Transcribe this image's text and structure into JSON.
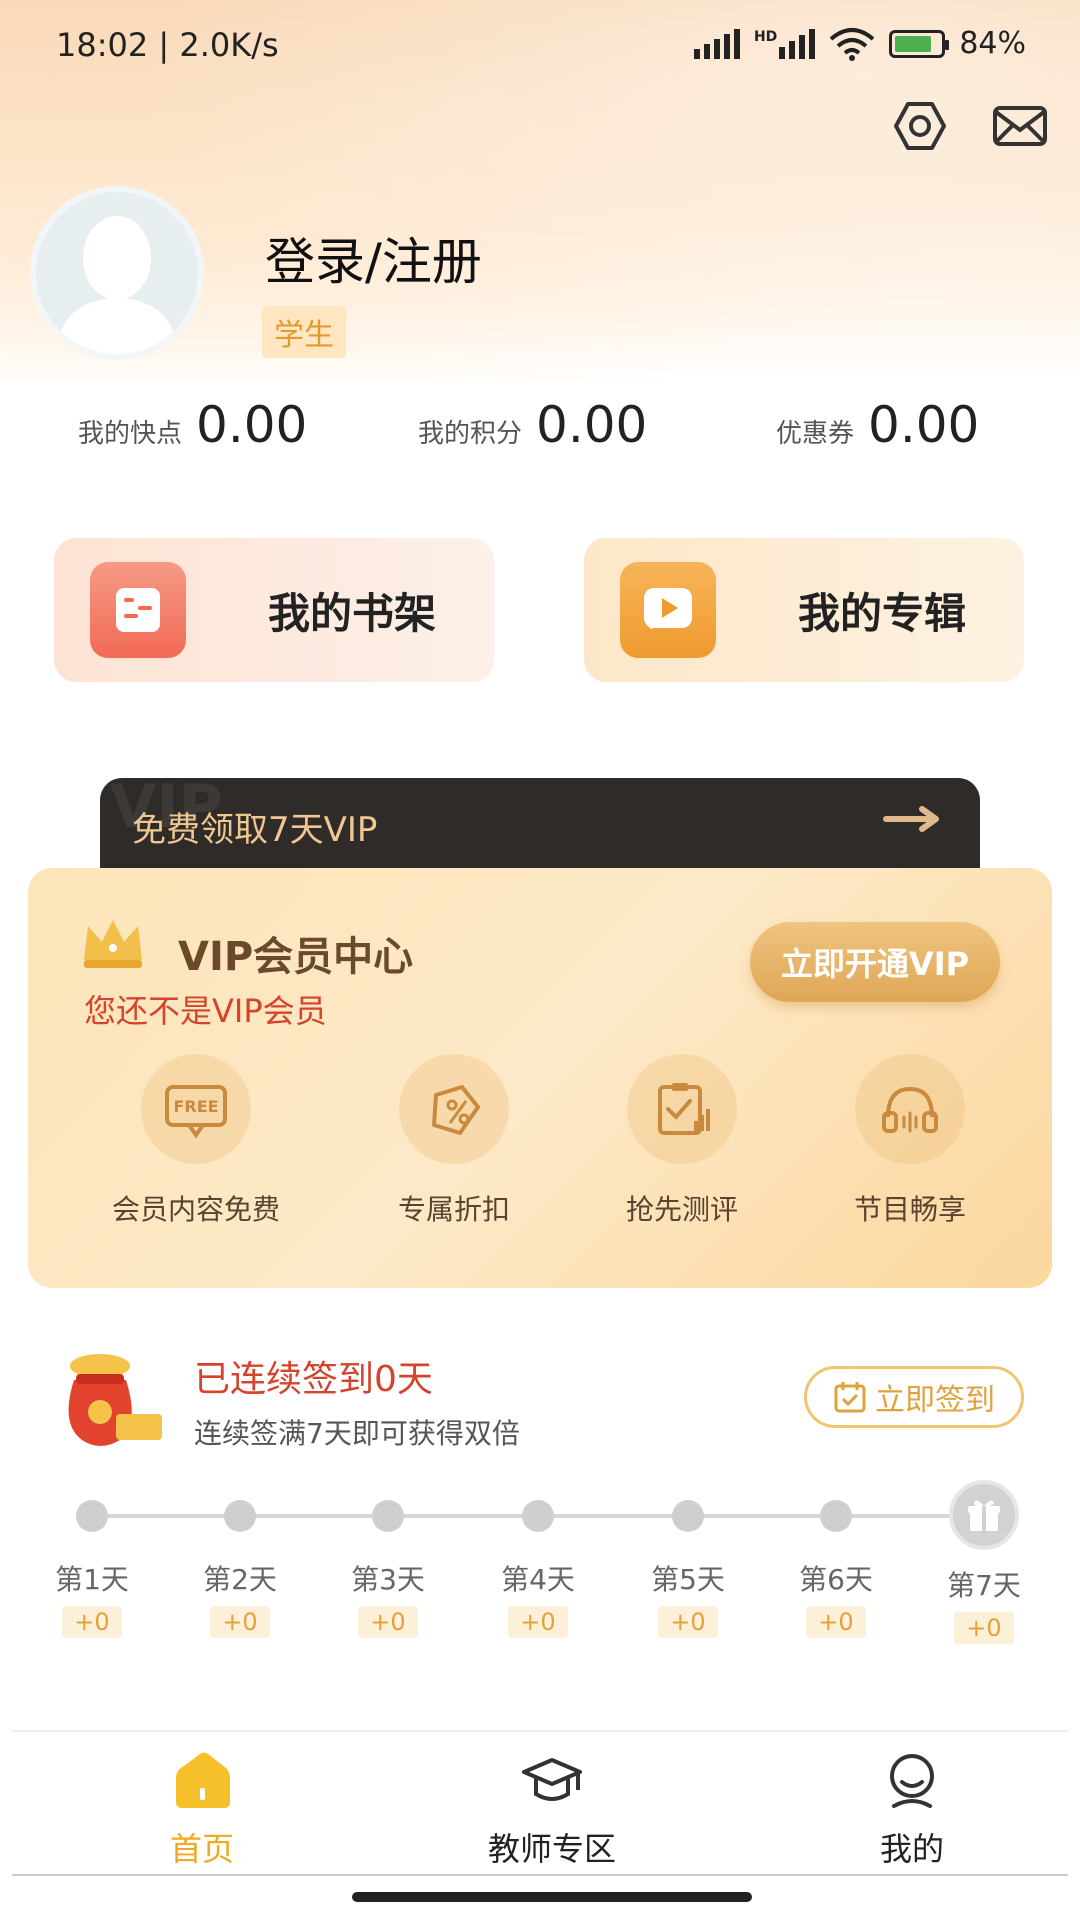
{
  "status_bar": {
    "time": "18:02 | 2.0K/s",
    "network_label": "HD",
    "battery": "84%"
  },
  "header": {
    "login_label": "登录/注册",
    "role_tag": "学生"
  },
  "stats": [
    {
      "label": "我的快点",
      "value": "0.00"
    },
    {
      "label": "我的积分",
      "value": "0.00"
    },
    {
      "label": "优惠券",
      "value": "0.00"
    }
  ],
  "quick_links": {
    "bookshelf": "我的书架",
    "album": "我的专辑"
  },
  "vip_strip": {
    "text": "免费领取7天VIP",
    "watermark": "VIP"
  },
  "vip_card": {
    "title": "VIP会员中心",
    "subtitle": "您还不是VIP会员",
    "open_button": "立即开通VIP",
    "free_icon_text": "FREE",
    "perks": [
      {
        "label": "会员内容免费",
        "icon": "free-icon"
      },
      {
        "label": "专属折扣",
        "icon": "discount-icon"
      },
      {
        "label": "抢先测评",
        "icon": "clipboard-check-icon"
      },
      {
        "label": "节目畅享",
        "icon": "headphones-icon"
      }
    ]
  },
  "checkin": {
    "streak_text": "已连续签到0天",
    "hint_text": "连续签满7天即可获得双倍",
    "button_label": "立即签到",
    "days": [
      {
        "label": "第1天",
        "points": "+0"
      },
      {
        "label": "第2天",
        "points": "+0"
      },
      {
        "label": "第3天",
        "points": "+0"
      },
      {
        "label": "第4天",
        "points": "+0"
      },
      {
        "label": "第5天",
        "points": "+0"
      },
      {
        "label": "第6天",
        "points": "+0"
      },
      {
        "label": "第7天",
        "points": "+0"
      }
    ]
  },
  "tabbar": {
    "home": "首页",
    "teacher": "教师专区",
    "mine": "我的",
    "active": "home"
  },
  "colors": {
    "accent": "#f0a920",
    "vip_gold": "#dfa657",
    "alert_red": "#d4442c"
  }
}
